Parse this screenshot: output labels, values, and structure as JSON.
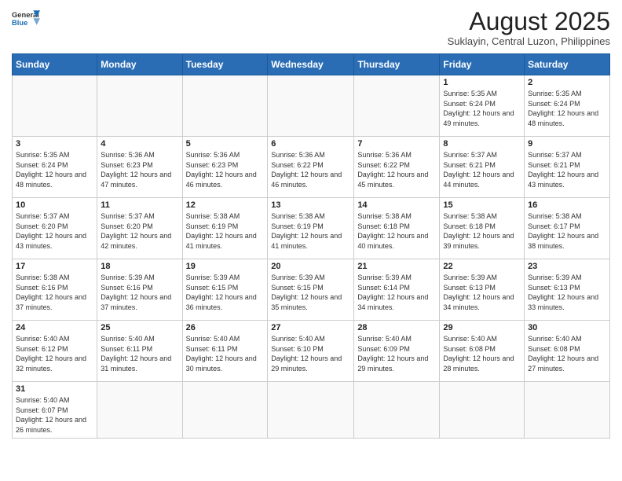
{
  "header": {
    "logo_general": "General",
    "logo_blue": "Blue",
    "month_year": "August 2025",
    "location": "Suklayin, Central Luzon, Philippines"
  },
  "weekdays": [
    "Sunday",
    "Monday",
    "Tuesday",
    "Wednesday",
    "Thursday",
    "Friday",
    "Saturday"
  ],
  "weeks": [
    [
      null,
      null,
      null,
      null,
      null,
      {
        "day": 1,
        "sunrise": "5:35 AM",
        "sunset": "6:24 PM",
        "daylight": "12 hours and 49 minutes."
      },
      {
        "day": 2,
        "sunrise": "5:35 AM",
        "sunset": "6:24 PM",
        "daylight": "12 hours and 48 minutes."
      }
    ],
    [
      {
        "day": 3,
        "sunrise": "5:35 AM",
        "sunset": "6:24 PM",
        "daylight": "12 hours and 48 minutes."
      },
      {
        "day": 4,
        "sunrise": "5:36 AM",
        "sunset": "6:23 PM",
        "daylight": "12 hours and 47 minutes."
      },
      {
        "day": 5,
        "sunrise": "5:36 AM",
        "sunset": "6:23 PM",
        "daylight": "12 hours and 46 minutes."
      },
      {
        "day": 6,
        "sunrise": "5:36 AM",
        "sunset": "6:22 PM",
        "daylight": "12 hours and 46 minutes."
      },
      {
        "day": 7,
        "sunrise": "5:36 AM",
        "sunset": "6:22 PM",
        "daylight": "12 hours and 45 minutes."
      },
      {
        "day": 8,
        "sunrise": "5:37 AM",
        "sunset": "6:21 PM",
        "daylight": "12 hours and 44 minutes."
      },
      {
        "day": 9,
        "sunrise": "5:37 AM",
        "sunset": "6:21 PM",
        "daylight": "12 hours and 43 minutes."
      }
    ],
    [
      {
        "day": 10,
        "sunrise": "5:37 AM",
        "sunset": "6:20 PM",
        "daylight": "12 hours and 43 minutes."
      },
      {
        "day": 11,
        "sunrise": "5:37 AM",
        "sunset": "6:20 PM",
        "daylight": "12 hours and 42 minutes."
      },
      {
        "day": 12,
        "sunrise": "5:38 AM",
        "sunset": "6:19 PM",
        "daylight": "12 hours and 41 minutes."
      },
      {
        "day": 13,
        "sunrise": "5:38 AM",
        "sunset": "6:19 PM",
        "daylight": "12 hours and 41 minutes."
      },
      {
        "day": 14,
        "sunrise": "5:38 AM",
        "sunset": "6:18 PM",
        "daylight": "12 hours and 40 minutes."
      },
      {
        "day": 15,
        "sunrise": "5:38 AM",
        "sunset": "6:18 PM",
        "daylight": "12 hours and 39 minutes."
      },
      {
        "day": 16,
        "sunrise": "5:38 AM",
        "sunset": "6:17 PM",
        "daylight": "12 hours and 38 minutes."
      }
    ],
    [
      {
        "day": 17,
        "sunrise": "5:38 AM",
        "sunset": "6:16 PM",
        "daylight": "12 hours and 37 minutes."
      },
      {
        "day": 18,
        "sunrise": "5:39 AM",
        "sunset": "6:16 PM",
        "daylight": "12 hours and 37 minutes."
      },
      {
        "day": 19,
        "sunrise": "5:39 AM",
        "sunset": "6:15 PM",
        "daylight": "12 hours and 36 minutes."
      },
      {
        "day": 20,
        "sunrise": "5:39 AM",
        "sunset": "6:15 PM",
        "daylight": "12 hours and 35 minutes."
      },
      {
        "day": 21,
        "sunrise": "5:39 AM",
        "sunset": "6:14 PM",
        "daylight": "12 hours and 34 minutes."
      },
      {
        "day": 22,
        "sunrise": "5:39 AM",
        "sunset": "6:13 PM",
        "daylight": "12 hours and 34 minutes."
      },
      {
        "day": 23,
        "sunrise": "5:39 AM",
        "sunset": "6:13 PM",
        "daylight": "12 hours and 33 minutes."
      }
    ],
    [
      {
        "day": 24,
        "sunrise": "5:40 AM",
        "sunset": "6:12 PM",
        "daylight": "12 hours and 32 minutes."
      },
      {
        "day": 25,
        "sunrise": "5:40 AM",
        "sunset": "6:11 PM",
        "daylight": "12 hours and 31 minutes."
      },
      {
        "day": 26,
        "sunrise": "5:40 AM",
        "sunset": "6:11 PM",
        "daylight": "12 hours and 30 minutes."
      },
      {
        "day": 27,
        "sunrise": "5:40 AM",
        "sunset": "6:10 PM",
        "daylight": "12 hours and 29 minutes."
      },
      {
        "day": 28,
        "sunrise": "5:40 AM",
        "sunset": "6:09 PM",
        "daylight": "12 hours and 29 minutes."
      },
      {
        "day": 29,
        "sunrise": "5:40 AM",
        "sunset": "6:08 PM",
        "daylight": "12 hours and 28 minutes."
      },
      {
        "day": 30,
        "sunrise": "5:40 AM",
        "sunset": "6:08 PM",
        "daylight": "12 hours and 27 minutes."
      }
    ],
    [
      {
        "day": 31,
        "sunrise": "5:40 AM",
        "sunset": "6:07 PM",
        "daylight": "12 hours and 26 minutes."
      },
      null,
      null,
      null,
      null,
      null,
      null
    ]
  ]
}
